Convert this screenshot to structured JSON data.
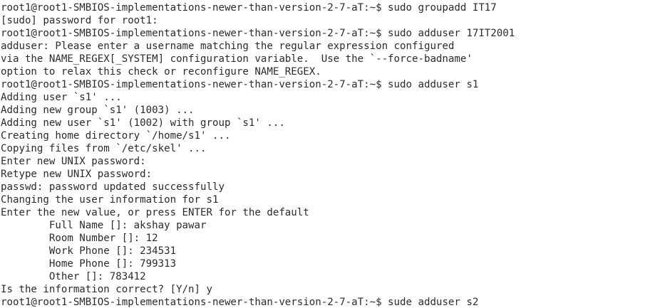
{
  "terminal": {
    "lines": [
      "root1@root1-SMBIOS-implementations-newer-than-version-2-7-aT:~$ sudo groupadd IT17",
      "[sudo] password for root1:",
      "root1@root1-SMBIOS-implementations-newer-than-version-2-7-aT:~$ sudo adduser 17IT2001",
      "adduser: Please enter a username matching the regular expression configured",
      "via the NAME_REGEX[_SYSTEM] configuration variable.  Use the `--force-badname'",
      "option to relax this check or reconfigure NAME_REGEX.",
      "root1@root1-SMBIOS-implementations-newer-than-version-2-7-aT:~$ sudo adduser s1",
      "Adding user `s1' ...",
      "Adding new group `s1' (1003) ...",
      "Adding new user `s1' (1002) with group `s1' ...",
      "Creating home directory `/home/s1' ...",
      "Copying files from `/etc/skel' ...",
      "Enter new UNIX password:",
      "Retype new UNIX password:",
      "passwd: password updated successfully",
      "Changing the user information for s1",
      "Enter the new value, or press ENTER for the default",
      "        Full Name []: akshay pawar",
      "        Room Number []: 12",
      "        Work Phone []: 234531",
      "        Home Phone []: 799313",
      "        Other []: 783412",
      "Is the information correct? [Y/n] y",
      "root1@root1-SMBIOS-implementations-newer-than-version-2-7-aT:~$ sude adduser s2"
    ]
  }
}
